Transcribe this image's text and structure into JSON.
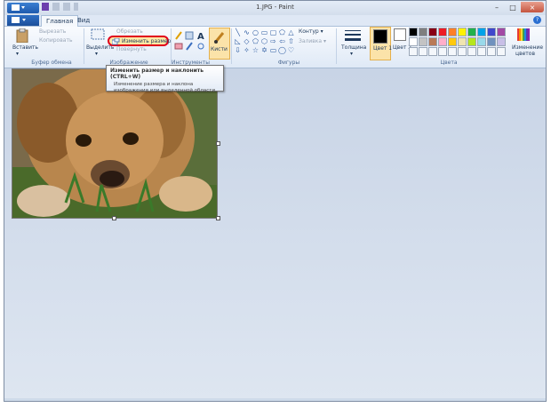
{
  "window": {
    "title": "1.JPG - Paint"
  },
  "tabs": [
    {
      "label": "Главная"
    },
    {
      "label": "Вид"
    }
  ],
  "clipboard": {
    "paste": "Вставить",
    "cut": "Вырезать",
    "copy": "Копировать",
    "group": "Буфер обмена"
  },
  "image_group": {
    "select": "Выделить",
    "crop": "Обрезать",
    "resize": "Изменить размер",
    "rotate": "Повернуть",
    "group": "Изображение"
  },
  "tools": {
    "group": "Инструменты"
  },
  "brushes": {
    "label": "Кисти"
  },
  "shapes": {
    "outline": "Контур",
    "fill": "Заливка",
    "group": "Фигуры"
  },
  "size": {
    "label": "Толщина"
  },
  "colors": {
    "color1": "Цвет 1",
    "color2": "Цвет 2",
    "edit": "Изменение цветов",
    "group": "Цвета",
    "palette": [
      "#000000",
      "#7f7f7f",
      "#880015",
      "#ed1c24",
      "#ff7f27",
      "#fff200",
      "#22b14c",
      "#00a2e8",
      "#3f48cc",
      "#a349a4",
      "#ffffff",
      "#c3c3c3",
      "#b97a57",
      "#ffaec9",
      "#ffc90e",
      "#efe4b0",
      "#b5e61d",
      "#99d9ea",
      "#7092be",
      "#c8bfe7"
    ]
  },
  "tooltip": {
    "title": "Изменить размер и наклонить (CTRL+W)",
    "description": "Изменение размера и наклона изображения или выделенной области."
  }
}
